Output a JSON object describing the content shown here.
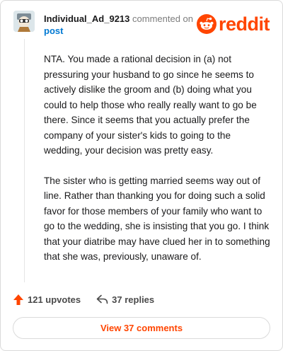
{
  "header": {
    "username": "Individual_Ad_9213",
    "commented_text": "commented on",
    "post_link": "post",
    "logo_text": "reddit"
  },
  "comment": {
    "paragraphs": [
      "NTA. You made a rational decision in (a) not pressuring your husband to go since he seems to actively dislike the groom and (b) doing what you could to help those who really really want to go be there. Since it seems that you actually prefer the company of your sister's kids to going to the wedding, your decision was pretty easy.",
      "The sister who is getting married seems way out of line. Rather than thanking you for doing such a solid favor for those members of your family who want to go to the wedding, she is insisting that you go. I think that your diatribe may have clued her in to something that she was, previously, unaware of."
    ]
  },
  "actions": {
    "upvotes": "121 upvotes",
    "replies": "37 replies"
  },
  "footer": {
    "view_comments": "View 37 comments"
  },
  "icons": {
    "upvote": "upvote-arrow-icon",
    "reply": "reply-arrow-icon",
    "logo": "reddit-snoo-icon"
  },
  "colors": {
    "brand": "#ff4500",
    "link": "#0079d3",
    "text": "#1a1a1b",
    "muted": "#7c7c7c"
  }
}
